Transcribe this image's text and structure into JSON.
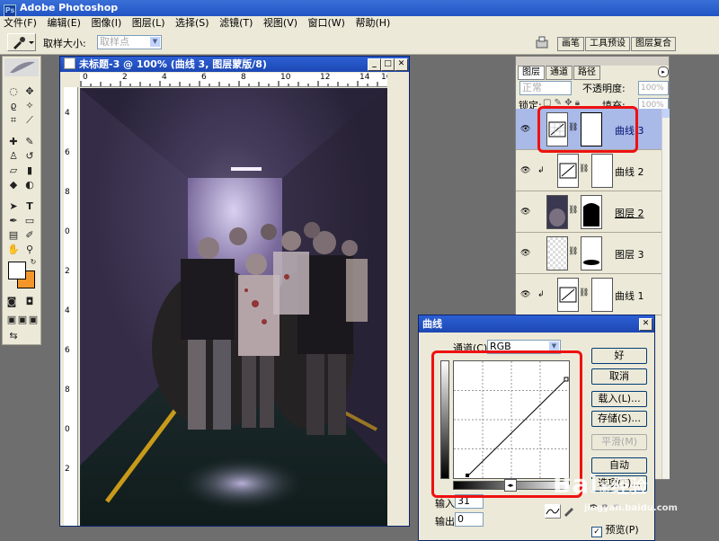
{
  "app": {
    "title": "Adobe Photoshop"
  },
  "menu": [
    "文件(F)",
    "编辑(E)",
    "图像(I)",
    "图层(L)",
    "选择(S)",
    "滤镜(T)",
    "视图(V)",
    "窗口(W)",
    "帮助(H)"
  ],
  "options": {
    "sample_size_label": "取样大小:",
    "sample_size_value": "取样点"
  },
  "palette_tabs": [
    "画笔",
    "工具预设",
    "图层复合"
  ],
  "document": {
    "title": "未标题-3 @ 100% (曲线 3, 图层蒙版/8)",
    "ruler_h": [
      "0",
      "2",
      "4",
      "6",
      "8",
      "10",
      "12",
      "14",
      "16"
    ],
    "ruler_v": [
      "4",
      "6",
      "8",
      "0",
      "2",
      "4",
      "6",
      "8",
      "0",
      "2"
    ]
  },
  "layers_panel": {
    "tabs": [
      "图层",
      "通道",
      "路径"
    ],
    "blend_mode": "正常",
    "opacity_label": "不透明度:",
    "opacity_value": "100%",
    "lock_label": "锁定:",
    "fill_label": "填充:",
    "fill_value": "100%",
    "layers": [
      {
        "name": "曲线 3",
        "selected": true
      },
      {
        "name": "曲线 2",
        "selected": false
      },
      {
        "name": "图层 2",
        "selected": false
      },
      {
        "name": "图层 3",
        "selected": false
      },
      {
        "name": "曲线 1",
        "selected": false
      }
    ]
  },
  "curves_dialog": {
    "title": "曲线",
    "channel_label": "通道(C):",
    "channel_value": "RGB",
    "buttons": {
      "ok": "好",
      "cancel": "取消",
      "load": "载入(L)...",
      "save": "存储(S)...",
      "smooth": "平滑(M)",
      "auto": "自动",
      "options": "选项(T)..."
    },
    "input_label": "输入:",
    "input_value": "31",
    "output_label": "输出:",
    "output_value": "0",
    "preview_label": "预览(P)"
  },
  "watermark": {
    "text": "Bai",
    "suffix": "经验",
    "domain": "jingyan.baidu.com"
  }
}
